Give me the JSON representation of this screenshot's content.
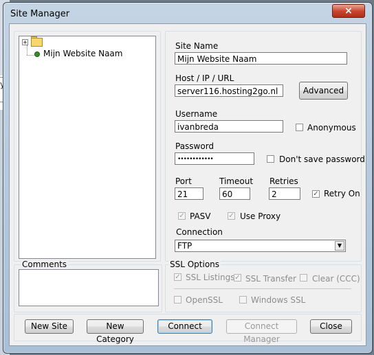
{
  "window": {
    "title": "Site Manager",
    "close_glyph": "×"
  },
  "background": {
    "glyph": "y"
  },
  "tree": {
    "root_expander": "+",
    "items": [
      {
        "label": "Mijn Website Naam"
      }
    ]
  },
  "comments": {
    "label": "Comments",
    "value": ""
  },
  "site_name": {
    "label": "Site Name",
    "value": "Mijn Website Naam"
  },
  "host": {
    "label": "Host / IP / URL",
    "value": "server116.hosting2go.nl",
    "advanced_label": "Advanced"
  },
  "username": {
    "label": "Username",
    "value": "ivanbreda"
  },
  "anonymous": {
    "label": "Anonymous",
    "checked": false
  },
  "password": {
    "label": "Password",
    "value": "••••••••••••"
  },
  "dont_save_password": {
    "label": "Don't save password",
    "checked": false
  },
  "port": {
    "label": "Port",
    "value": "21"
  },
  "timeout": {
    "label": "Timeout",
    "value": "60"
  },
  "retries": {
    "label": "Retries",
    "value": "2"
  },
  "retry_on": {
    "label": "Retry On",
    "checked": true
  },
  "pasv": {
    "label": "PASV",
    "checked": true
  },
  "use_proxy": {
    "label": "Use Proxy",
    "checked": true
  },
  "connection": {
    "label": "Connection",
    "selected": "FTP"
  },
  "ssl": {
    "label": "SSL Options",
    "ssl_listings": {
      "label": "SSL Listings",
      "checked": true
    },
    "ssl_transfer": {
      "label": "SSL Transfer",
      "checked": true
    },
    "clear_ccc": {
      "label": "Clear (CCC)",
      "checked": false
    },
    "openssl": {
      "label": "OpenSSL",
      "checked": false
    },
    "windows_ssl": {
      "label": "Windows SSL",
      "checked": false
    }
  },
  "buttons": {
    "new_site": "New Site",
    "new_category": "New Category",
    "connect": "Connect",
    "connect_manager": "Connect Manager",
    "close": "Close"
  },
  "check_glyph": "✓"
}
